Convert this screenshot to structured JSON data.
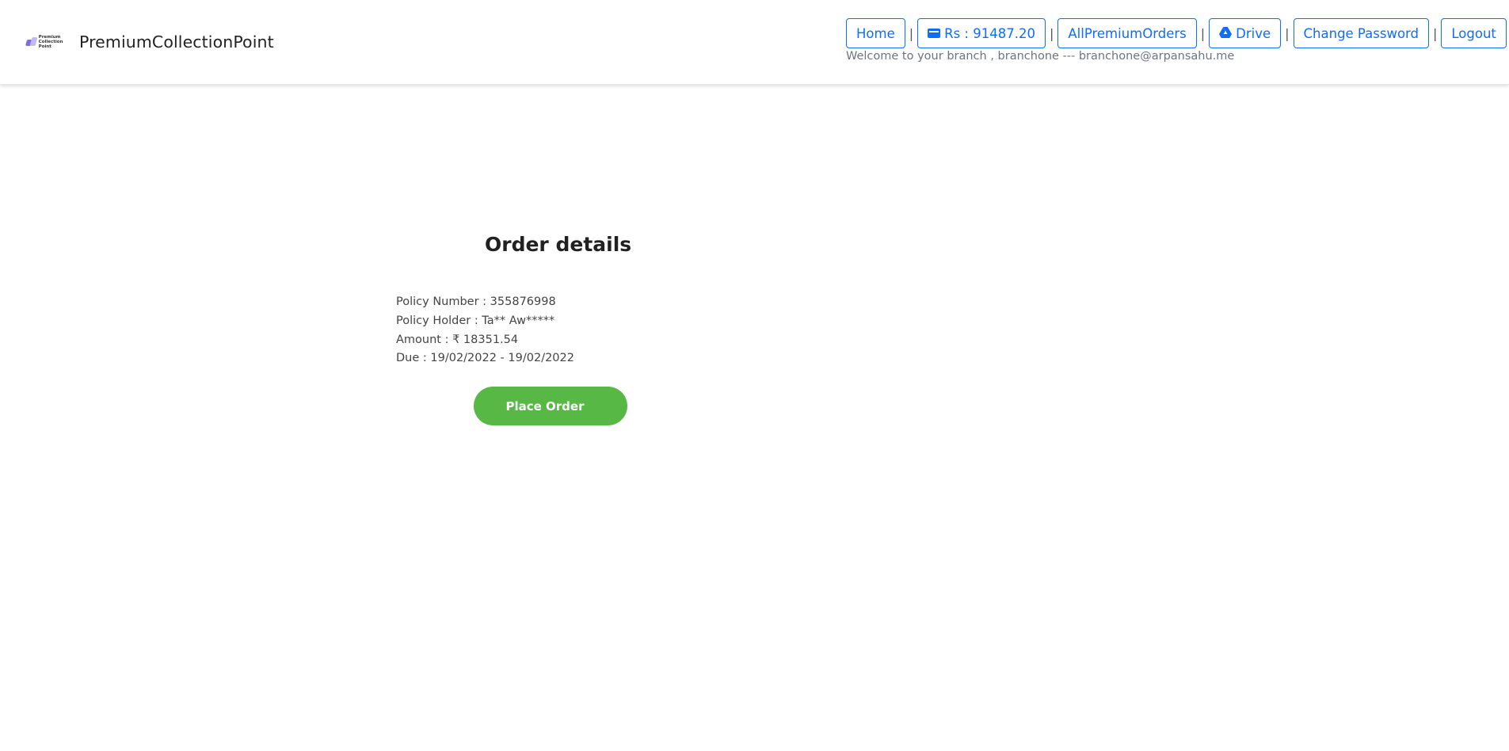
{
  "header": {
    "logo_icon": "premium-collection-point-logo",
    "logo_text_line1": "Premium",
    "logo_text_line2": "Collection Point",
    "brand_name": "PremiumCollectionPoint",
    "nav": {
      "home": "Home",
      "wallet": "Rs : 91487.20",
      "wallet_icon": "wallet-icon",
      "all_orders": "AllPremiumOrders",
      "drive": "Drive",
      "drive_icon": "google-drive-icon",
      "change_password": "Change Password",
      "logout": "Logout",
      "separator": "|"
    },
    "welcome_text": "Welcome to your branch , branchone --- branchone@arpansahu.me"
  },
  "order": {
    "title": "Order details",
    "policy_number": "Policy Number : 355876998",
    "policy_holder": "Policy Holder : Ta** Aw*****",
    "amount": "Amount : ₹ 18351.54",
    "due": "Due : 19/02/2022 - 19/02/2022",
    "place_order_label": "Place Order"
  },
  "colors": {
    "primary": "#0d6efd",
    "success_button": "#57b846",
    "muted_text": "#6c757d"
  }
}
